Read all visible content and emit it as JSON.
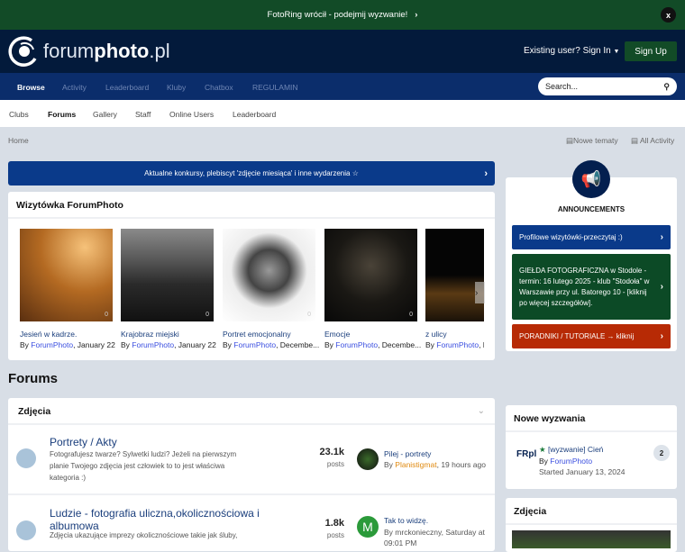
{
  "topbar": {
    "text": "FotoRing wrócił - podejmij wyzwanie!",
    "close": "x"
  },
  "header": {
    "logo_light": "forum",
    "logo_bold": "photo",
    "logo_tail": ".pl",
    "signin": "Existing user? Sign In",
    "signup": "Sign Up"
  },
  "nav": {
    "items": [
      "Browse",
      "Activity",
      "Leaderboard",
      "Kluby",
      "Chatbox",
      "REGULAMIN"
    ],
    "search_placeholder": "Search..."
  },
  "subnav": [
    "Clubs",
    "Forums",
    "Gallery",
    "Staff",
    "Online Users",
    "Leaderboard"
  ],
  "breadcrumb": {
    "home": "Home",
    "new_topics": "Nowe tematy",
    "all_activity": "All Activity"
  },
  "banner": "Aktualne konkursy, plebiscyt 'zdjęcie miesiąca' i inne wydarzenia ☆",
  "showcase": {
    "title": "Wizytówka ForumPhoto",
    "items": [
      {
        "title": "Jesień w kadrze.",
        "author": "ForumPhoto",
        "date": ", January 22",
        "comments": "0"
      },
      {
        "title": "Krajobraz miejski",
        "author": "ForumPhoto",
        "date": ", January 22",
        "comments": "0"
      },
      {
        "title": "Portret emocjonalny",
        "author": "ForumPhoto",
        "date": ", Decembe...",
        "comments": "0"
      },
      {
        "title": "Emocje",
        "author": "ForumPhoto",
        "date": ", Decembe...",
        "comments": "0"
      },
      {
        "title": "z ulicy",
        "author": "ForumPhoto",
        "date": ", N",
        "comments": ""
      }
    ]
  },
  "by": "By ",
  "forums": {
    "heading": "Forums",
    "category": "Zdjęcia",
    "rows": [
      {
        "title": "Portrety / Akty",
        "desc": "Fotografujesz twarze? Sylwetki ludzi? Jeżeli na pierwszym planie Twojego zdjęcia jest człowiek to to jest właściwa kategoria :)",
        "count": "23.1k",
        "unit": "posts",
        "last_title": "Pilej - portrety",
        "last_author": "Planistigmat",
        "last_time": ", 19 hours ago"
      },
      {
        "title": "Ludzie - fotografia uliczna,okolicznościowa i albumowa",
        "desc": "Zdjęcia ukazujące imprezy okolicznościowe takie jak śluby,",
        "count": "1.8k",
        "unit": "posts",
        "last_title": "Tak to widzę.",
        "last_author": "mrckonieczny",
        "last_time": ", Saturday at 09:01 PM",
        "avatar_letter": "M"
      }
    ]
  },
  "announcements": {
    "title": "ANNOUNCEMENTS",
    "items": [
      "Profilowe wizytówki-przeczytaj :)",
      "GIEŁDA FOTOGRAFICZNA w Stodole - termin: 16 lutego 2025 - klub \"Stodoła\" w Warszawie przy ul. Batorego 10 - [kliknij po więcej szczegółów].",
      "PORADNIKI / TUTORIALE → kliknij"
    ]
  },
  "challenges": {
    "title": "Nowe wyzwania",
    "logo": "FRpl",
    "topic": "[wyzwanie] Cień",
    "author": "ForumPhoto",
    "started": "Started January 13, 2024",
    "replies": "2"
  },
  "photos": {
    "title": "Zdjęcia"
  }
}
